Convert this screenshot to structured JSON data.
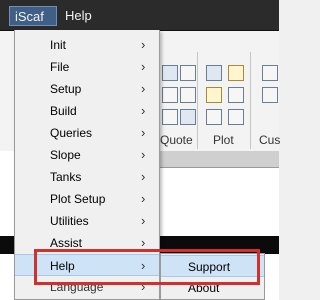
{
  "menubar": {
    "items": [
      {
        "label": "iScaf"
      },
      {
        "label": "Help"
      }
    ]
  },
  "ribbon": {
    "groups": [
      "Quote",
      "Plot",
      "Cus"
    ]
  },
  "dropdown": {
    "items": [
      {
        "label": "Init",
        "arrow": "›"
      },
      {
        "label": "File",
        "arrow": "›"
      },
      {
        "label": "Setup",
        "arrow": "›"
      },
      {
        "label": "Build",
        "arrow": "›"
      },
      {
        "label": "Queries",
        "arrow": "›"
      },
      {
        "label": "Slope",
        "arrow": "›"
      },
      {
        "label": "Tanks",
        "arrow": "›"
      },
      {
        "label": "Plot Setup",
        "arrow": "›"
      },
      {
        "label": "Utilities",
        "arrow": "›"
      },
      {
        "label": "Assist",
        "arrow": "›"
      },
      {
        "label": "Help",
        "arrow": "›"
      },
      {
        "label": "Language",
        "arrow": "›"
      }
    ]
  },
  "submenu": {
    "items": [
      {
        "label": "Support"
      },
      {
        "label": "About"
      }
    ]
  }
}
